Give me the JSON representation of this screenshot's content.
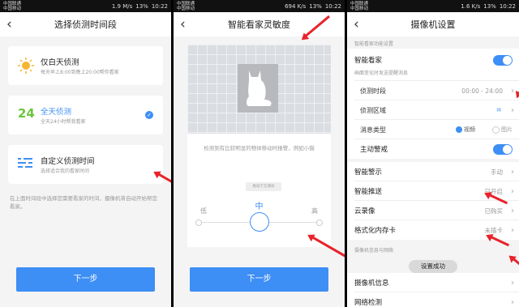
{
  "status": {
    "p1": {
      "carrier1": "中国联通",
      "carrier2": "中国移动",
      "speed": "1.9 M/s",
      "battery": "13%",
      "time": "10:22"
    },
    "p2": {
      "carrier1": "中国联通",
      "carrier2": "中国移动",
      "speed": "694 K/s",
      "battery": "13%",
      "time": "10:22"
    },
    "p3": {
      "carrier1": "中国联通",
      "carrier2": "中国移动",
      "speed": "1.6 K/s",
      "battery": "13%",
      "time": "10:22"
    }
  },
  "screen1": {
    "title": "选择侦测时间段",
    "options": [
      {
        "title": "仅白天侦测",
        "sub": "每天早上8:00到晚上20:00帮你看家",
        "icon": "sun-icon"
      },
      {
        "title": "全天侦测",
        "sub": "全天24小时帮我看家",
        "icon": "24-icon",
        "selected": true
      },
      {
        "title": "自定义侦测时间",
        "sub": "选择适合我的看家时间",
        "icon": "custom-list-icon"
      }
    ],
    "note": "在上面时间段中选择您需要看家的时间，摄像机将自动开始帮您看家。",
    "next": "下一步"
  },
  "screen2": {
    "title": "智能看家灵敏度",
    "desc": "检测到有比较明显的物体移动时报警，例如小猫",
    "drag_hint": "拖动下方滑块",
    "level_low": "低",
    "level_mid": "中",
    "level_high": "高",
    "level_value": 0.5,
    "next": "下一步"
  },
  "screen3": {
    "title": "摄像机设置",
    "section1": "智能看家功能设置",
    "smart": {
      "label": "智能看家",
      "sub": "画面变化时发送提醒消息"
    },
    "period": {
      "label": "侦测时段",
      "value": "00:00 - 24:00"
    },
    "area": {
      "label": "侦测区域"
    },
    "msgtype": {
      "label": "消息类型",
      "opt1": "视频",
      "opt2": "图片"
    },
    "alarm": {
      "label": "主动警戒"
    },
    "warn": {
      "label": "智能警示",
      "value": "手动"
    },
    "push": {
      "label": "智能推送",
      "value": "已开启"
    },
    "cloud": {
      "label": "云录像",
      "value": "已购买"
    },
    "sd": {
      "label": "格式化内存卡",
      "value": "未插卡"
    },
    "section2": "摄像机信息与网络",
    "toast": "设置成功",
    "info": {
      "label": "摄像机信息"
    },
    "net": {
      "label": "网络检测"
    }
  }
}
